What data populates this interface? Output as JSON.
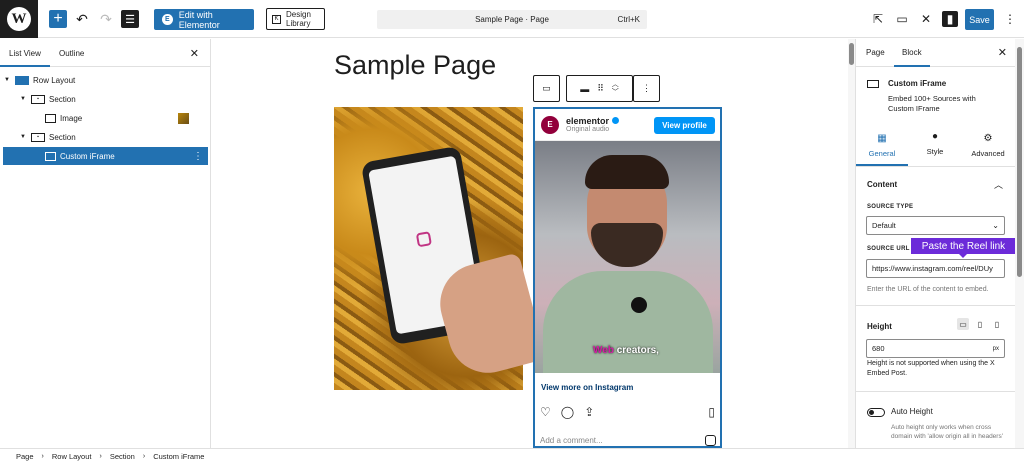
{
  "toolbar": {
    "wp_logo": "W",
    "elementor_label": "Edit with Elementor",
    "design_library_label_1": "Design",
    "design_library_label_2": "Library",
    "command_title": "Sample Page · Page",
    "command_shortcut": "Ctrl+K",
    "save_label": "Save"
  },
  "left_panel": {
    "tabs": [
      "List View",
      "Outline"
    ],
    "items": [
      {
        "label": "Row Layout"
      },
      {
        "label": "Section"
      },
      {
        "label": "Image"
      },
      {
        "label": "Section"
      },
      {
        "label": "Custom iFrame"
      }
    ]
  },
  "canvas": {
    "page_title": "Sample Page",
    "instagram": {
      "avatar_letter": "E",
      "username": "elementor",
      "subtitle": "Original audio",
      "view_profile": "View profile",
      "caption_highlight": "Web",
      "caption_rest": " creators,",
      "view_more": "View more on Instagram",
      "comment_placeholder": "Add a comment..."
    }
  },
  "right_panel": {
    "tabs": [
      "Page",
      "Block"
    ],
    "block_name": "Custom iFrame",
    "block_desc": "Embed 100+ Sources with Custom IFrame",
    "group_tabs": [
      "General",
      "Style",
      "Advanced"
    ],
    "content_section": "Content",
    "source_type_label": "SOURCE TYPE",
    "source_type_value": "Default",
    "source_url_label": "SOURCE URL",
    "tooltip": "Paste the Reel link",
    "source_url_value": "https://www.instagram.com/reel/DUy",
    "source_url_help": "Enter the URL of the content to embed.",
    "height_label": "Height",
    "height_value": "680",
    "height_unit": "px",
    "height_help": "Height is not supported when using the X Embed Post.",
    "auto_height_label": "Auto Height",
    "auto_height_help": "Auto height only works when cross domain with 'allow origin all in headers'"
  },
  "breadcrumb": [
    "Page",
    "Row Layout",
    "Section",
    "Custom iFrame"
  ],
  "colors": {
    "accent": "#2271b1",
    "tooltip": "#6c2bd9",
    "instagram_blue": "#0095f6"
  }
}
